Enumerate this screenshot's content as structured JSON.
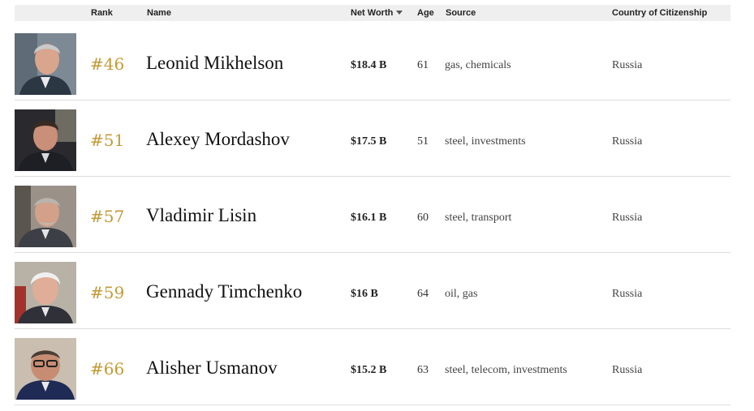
{
  "header": {
    "rank": "Rank",
    "name": "Name",
    "net_worth": "Net Worth",
    "age": "Age",
    "source": "Source",
    "country": "Country of Citizenship"
  },
  "rows": [
    {
      "rank": "#46",
      "name": "Leonid Mikhelson",
      "net_worth": "$18.4 B",
      "age": "61",
      "source": "gas, chemicals",
      "country": "Russia"
    },
    {
      "rank": "#51",
      "name": "Alexey Mordashov",
      "net_worth": "$17.5 B",
      "age": "51",
      "source": "steel, investments",
      "country": "Russia"
    },
    {
      "rank": "#57",
      "name": "Vladimir Lisin",
      "net_worth": "$16.1 B",
      "age": "60",
      "source": "steel, transport",
      "country": "Russia"
    },
    {
      "rank": "#59",
      "name": "Gennady Timchenko",
      "net_worth": "$16 B",
      "age": "64",
      "source": "oil, gas",
      "country": "Russia"
    },
    {
      "rank": "#66",
      "name": "Alisher Usmanov",
      "net_worth": "$15.2 B",
      "age": "63",
      "source": "steel, telecom, investments",
      "country": "Russia"
    }
  ],
  "colors": {
    "rank_gold": "#c39a35",
    "header_bg": "#efefef",
    "row_divider": "#dddddd"
  }
}
